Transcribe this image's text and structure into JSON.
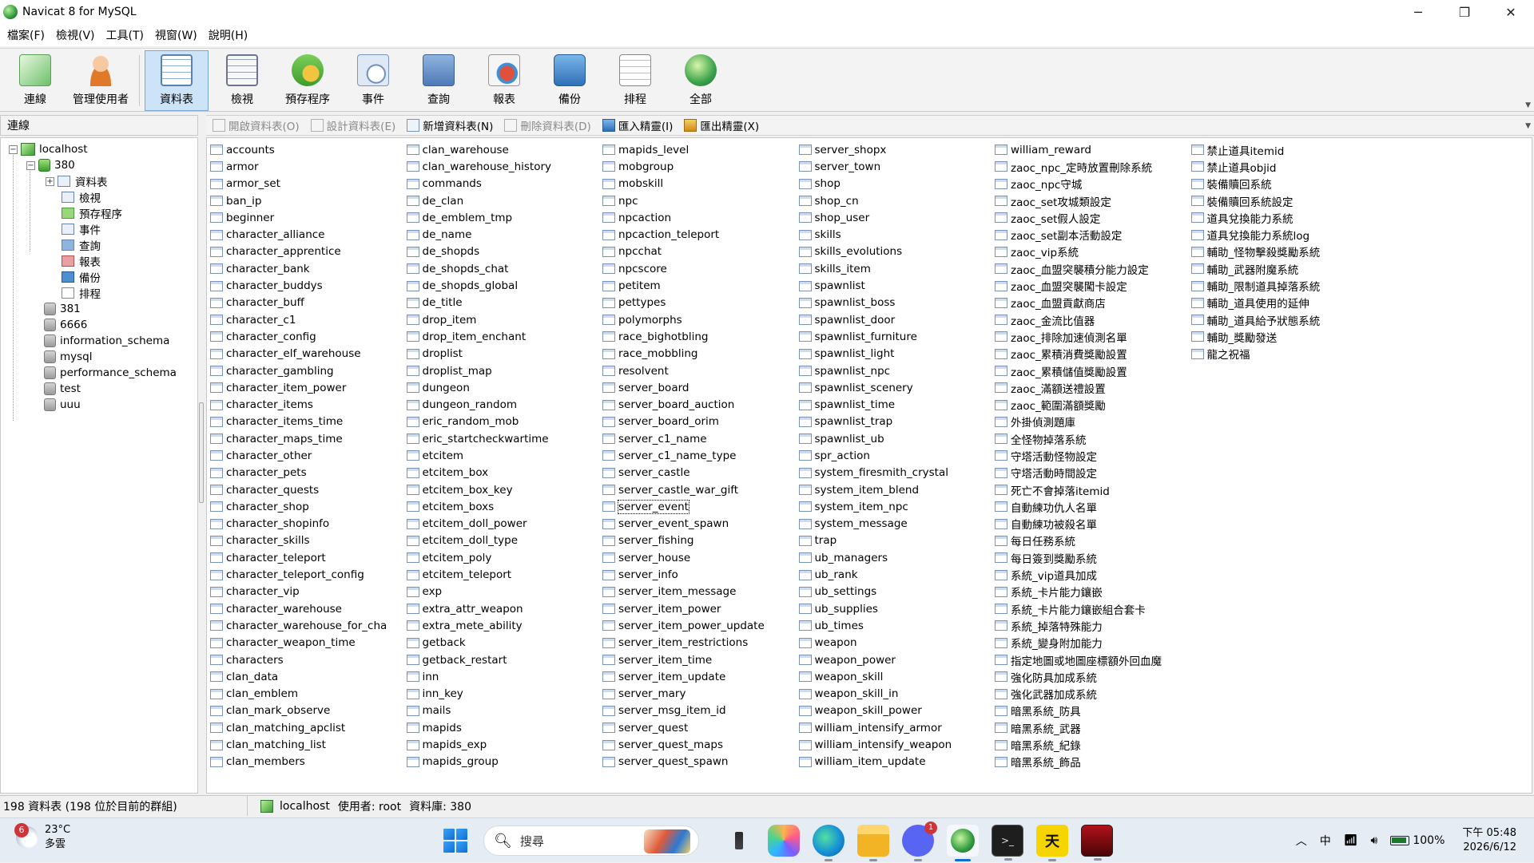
{
  "window": {
    "title": "Navicat 8 for MySQL",
    "controls": [
      "─",
      "❐",
      "✕"
    ]
  },
  "menubar": [
    "檔案(F)",
    "檢視(V)",
    "工具(T)",
    "視窗(W)",
    "說明(H)"
  ],
  "toolbar": [
    {
      "label": "連線",
      "icon": "connect-icon",
      "active": false
    },
    {
      "label": "管理使用者",
      "icon": "user-icon",
      "active": false
    },
    {
      "label": "資料表",
      "icon": "table-icon",
      "active": true
    },
    {
      "label": "檢視",
      "icon": "view-icon",
      "active": false
    },
    {
      "label": "預存程序",
      "icon": "procedure-icon",
      "active": false
    },
    {
      "label": "事件",
      "icon": "event-icon",
      "active": false
    },
    {
      "label": "查詢",
      "icon": "query-icon",
      "active": false
    },
    {
      "label": "報表",
      "icon": "report-icon",
      "active": false
    },
    {
      "label": "備份",
      "icon": "backup-icon",
      "active": false
    },
    {
      "label": "排程",
      "icon": "schedule-icon",
      "active": false
    },
    {
      "label": "全部",
      "icon": "all-icon",
      "active": false
    }
  ],
  "connections": {
    "header": "連線",
    "host": "localhost",
    "open_db": "380",
    "objects": [
      "資料表",
      "檢視",
      "預存程序",
      "事件",
      "查詢",
      "報表",
      "備份",
      "排程"
    ],
    "other_dbs": [
      "381",
      "6666",
      "information_schema",
      "mysql",
      "performance_schema",
      "test",
      "uuu"
    ]
  },
  "object_toolbar": [
    {
      "label": "開啟資料表(O)",
      "enabled": false,
      "icon": "open-table-icon"
    },
    {
      "label": "設計資料表(E)",
      "enabled": false,
      "icon": "design-table-icon"
    },
    {
      "label": "新增資料表(N)",
      "enabled": true,
      "icon": "new-table-icon"
    },
    {
      "label": "刪除資料表(D)",
      "enabled": false,
      "icon": "delete-table-icon"
    },
    {
      "label": "匯入精靈(I)",
      "enabled": true,
      "icon": "import-wizard-icon"
    },
    {
      "label": "匯出精靈(X)",
      "enabled": true,
      "icon": "export-wizard-icon"
    }
  ],
  "tables": [
    "accounts",
    "armor",
    "armor_set",
    "ban_ip",
    "beginner",
    "character_alliance",
    "character_apprentice",
    "character_bank",
    "character_buddys",
    "character_buff",
    "character_c1",
    "character_config",
    "character_elf_warehouse",
    "character_gambling",
    "character_item_power",
    "character_items",
    "character_items_time",
    "character_maps_time",
    "character_other",
    "character_pets",
    "character_quests",
    "character_shop",
    "character_shopinfo",
    "character_skills",
    "character_teleport",
    "character_teleport_config",
    "character_vip",
    "character_warehouse",
    "character_warehouse_for_cha",
    "character_weapon_time",
    "characters",
    "clan_data",
    "clan_emblem",
    "clan_mark_observe",
    "clan_matching_apclist",
    "clan_matching_list",
    "clan_members",
    "clan_warehouse",
    "clan_warehouse_history",
    "commands",
    "de_clan",
    "de_emblem_tmp",
    "de_name",
    "de_shopds",
    "de_shopds_chat",
    "de_shopds_global",
    "de_title",
    "drop_item",
    "drop_item_enchant",
    "droplist",
    "droplist_map",
    "dungeon",
    "dungeon_random",
    "eric_random_mob",
    "eric_startcheckwartime",
    "etcitem",
    "etcitem_box",
    "etcitem_box_key",
    "etcitem_boxs",
    "etcitem_doll_power",
    "etcitem_doll_type",
    "etcitem_poly",
    "etcitem_teleport",
    "exp",
    "extra_attr_weapon",
    "extra_mete_ability",
    "getback",
    "getback_restart",
    "inn",
    "inn_key",
    "mails",
    "mapids",
    "mapids_exp",
    "mapids_group",
    "mapids_level",
    "mobgroup",
    "mobskill",
    "npc",
    "npcaction",
    "npcaction_teleport",
    "npcchat",
    "npcscore",
    "petitem",
    "pettypes",
    "polymorphs",
    "race_bighotbling",
    "race_mobbling",
    "resolvent",
    "server_board",
    "server_board_auction",
    "server_board_orim",
    "server_c1_name",
    "server_c1_name_type",
    "server_castle",
    "server_castle_war_gift",
    "server_event",
    "server_event_spawn",
    "server_fishing",
    "server_house",
    "server_info",
    "server_item_message",
    "server_item_power",
    "server_item_power_update",
    "server_item_restrictions",
    "server_item_time",
    "server_item_update",
    "server_mary",
    "server_msg_item_id",
    "server_quest",
    "server_quest_maps",
    "server_quest_spawn",
    "server_shopx",
    "server_town",
    "shop",
    "shop_cn",
    "shop_user",
    "skills",
    "skills_evolutions",
    "skills_item",
    "spawnlist",
    "spawnlist_boss",
    "spawnlist_door",
    "spawnlist_furniture",
    "spawnlist_light",
    "spawnlist_npc",
    "spawnlist_scenery",
    "spawnlist_time",
    "spawnlist_trap",
    "spawnlist_ub",
    "spr_action",
    "system_firesmith_crystal",
    "system_item_blend",
    "system_item_npc",
    "system_message",
    "trap",
    "ub_managers",
    "ub_rank",
    "ub_settings",
    "ub_supplies",
    "ub_times",
    "weapon",
    "weapon_power",
    "weapon_skill",
    "weapon_skill_in",
    "weapon_skill_power",
    "william_intensify_armor",
    "william_intensify_weapon",
    "william_item_update",
    "william_reward",
    "zaoc_npc_定時放置刪除系統",
    "zaoc_npc守城",
    "zaoc_set攻城類設定",
    "zaoc_set假人設定",
    "zaoc_set副本活動設定",
    "zaoc_vip系統",
    "zaoc_血盟突襲積分能力設定",
    "zaoc_血盟突襲闖卡設定",
    "zaoc_血盟貢獻商店",
    "zaoc_金流比值器",
    "zaoc_排除加速偵測名單",
    "zaoc_累積消費獎勵設置",
    "zaoc_累積儲值獎勵設置",
    "zaoc_滿額送禮設置",
    "zaoc_範圍滿額獎勵",
    "外掛偵測題庫",
    "全怪物掉落系統",
    "守塔活動怪物設定",
    "守塔活動時間設定",
    "死亡不會掉落itemid",
    "自動練功仇人名單",
    "自動練功被殺名單",
    "每日任務系統",
    "每日簽到獎勵系統",
    "系統_vip道具加成",
    "系統_卡片能力鑲嵌",
    "系統_卡片能力鑲嵌組合套卡",
    "系統_掉落特殊能力",
    "系統_變身附加能力",
    "指定地圖或地圖座標額外回血魔",
    "強化防具加成系統",
    "強化武器加成系統",
    "暗黑系統_防具",
    "暗黑系統_武器",
    "暗黑系統_紀錄",
    "暗黑系統_飾品",
    "禁止道具itemid",
    "禁止道具objid",
    "裝備贖回系統",
    "裝備贖回系統設定",
    "道具兌換能力系統",
    "道具兌換能力系統log",
    "輔助_怪物擊殺獎勵系統",
    "輔助_武器附魔系統",
    "輔助_限制道具掉落系統",
    "輔助_道具使用的延伸",
    "輔助_道具給予狀態系統",
    "輔助_獎勵發送",
    "龍之祝福"
  ],
  "focused_table": "server_event",
  "statusbar": {
    "count": "198 資料表 (198 位於目前的群組)",
    "host": "localhost",
    "user_label": "使用者: root",
    "db_label": "資料庫: 380"
  },
  "taskbar": {
    "weather_badge": "6",
    "temperature": "23°C",
    "condition": "多雲",
    "search_placeholder": "搜尋",
    "discord_badge": "1",
    "terminal_glyph": ">_",
    "tian_glyph": "天",
    "ime": "中",
    "battery": "100%",
    "time": "下午 05:48",
    "date": "2026/6/12"
  }
}
